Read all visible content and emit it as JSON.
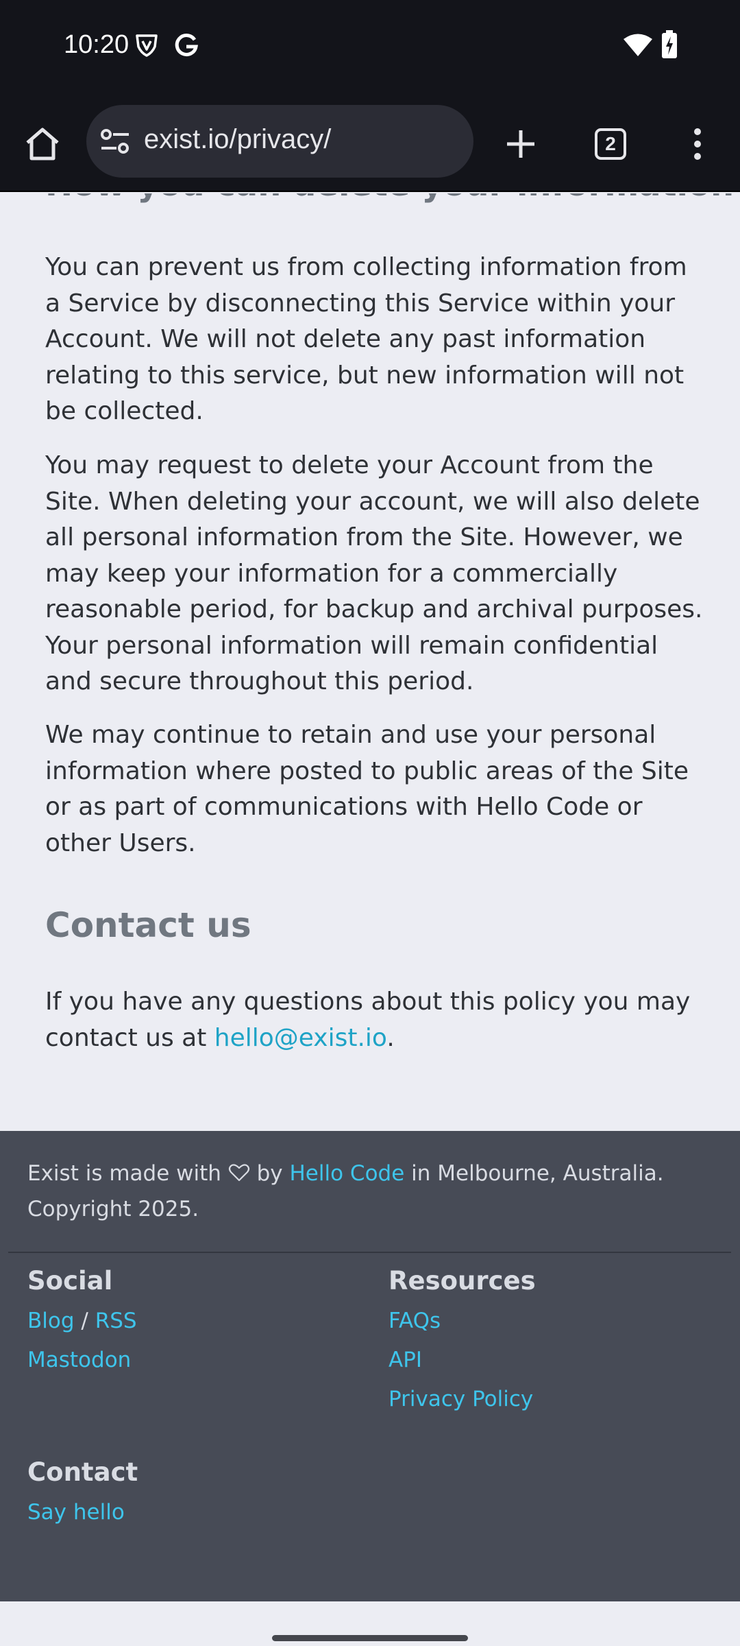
{
  "status_bar": {
    "time": "10:20",
    "icons": [
      "vpn-shield-icon",
      "google-icon",
      "wifi-icon",
      "battery-charging-icon"
    ]
  },
  "browser": {
    "url": "exist.io/privacy/",
    "tab_count": "2",
    "icons": [
      "home-icon",
      "site-settings-icon",
      "new-tab-plus-icon",
      "tabs-icon",
      "more-menu-icon"
    ]
  },
  "page": {
    "partial_heading": "How you can delete your information",
    "paragraphs": [
      "You can prevent us from collecting information from a Service by disconnecting this Service within your Account. We will not delete any past information relating to this service, but new information will not be collected.",
      "You may request to delete your Account from the Site. When deleting your account, we will also delete all personal information from the Site. However, we may keep your information for a commercially reasonable period, for backup and archival purposes. Your personal information will remain confidential and secure throughout this period.",
      "We may continue to retain and use your personal information where posted to public areas of the Site or as part of communications with Hello Code or other Users."
    ],
    "contact_heading": "Contact us",
    "contact_text_before": "If you have any questions about this policy you may contact us at ",
    "contact_email": "hello@exist.io",
    "contact_text_after": "."
  },
  "footer": {
    "made_prefix": "Exist is made with",
    "made_by": "by",
    "hello_code_link": "Hello Code",
    "made_suffix": "in Melbourne, Australia.",
    "copyright": "Copyright 2025.",
    "social": {
      "heading": "Social",
      "blog": "Blog",
      "separator": "/",
      "rss": "RSS",
      "mastodon": "Mastodon"
    },
    "resources": {
      "heading": "Resources",
      "links": [
        "FAQs",
        "API",
        "Privacy Policy"
      ]
    },
    "contact": {
      "heading": "Contact",
      "say_hello": "Say hello"
    }
  },
  "colors": {
    "link": "#1ea3c6",
    "footer_link": "#3ec5ec",
    "footer_bg": "#474b56",
    "page_bg": "#ecedf3",
    "chrome_bg": "#13141a"
  }
}
